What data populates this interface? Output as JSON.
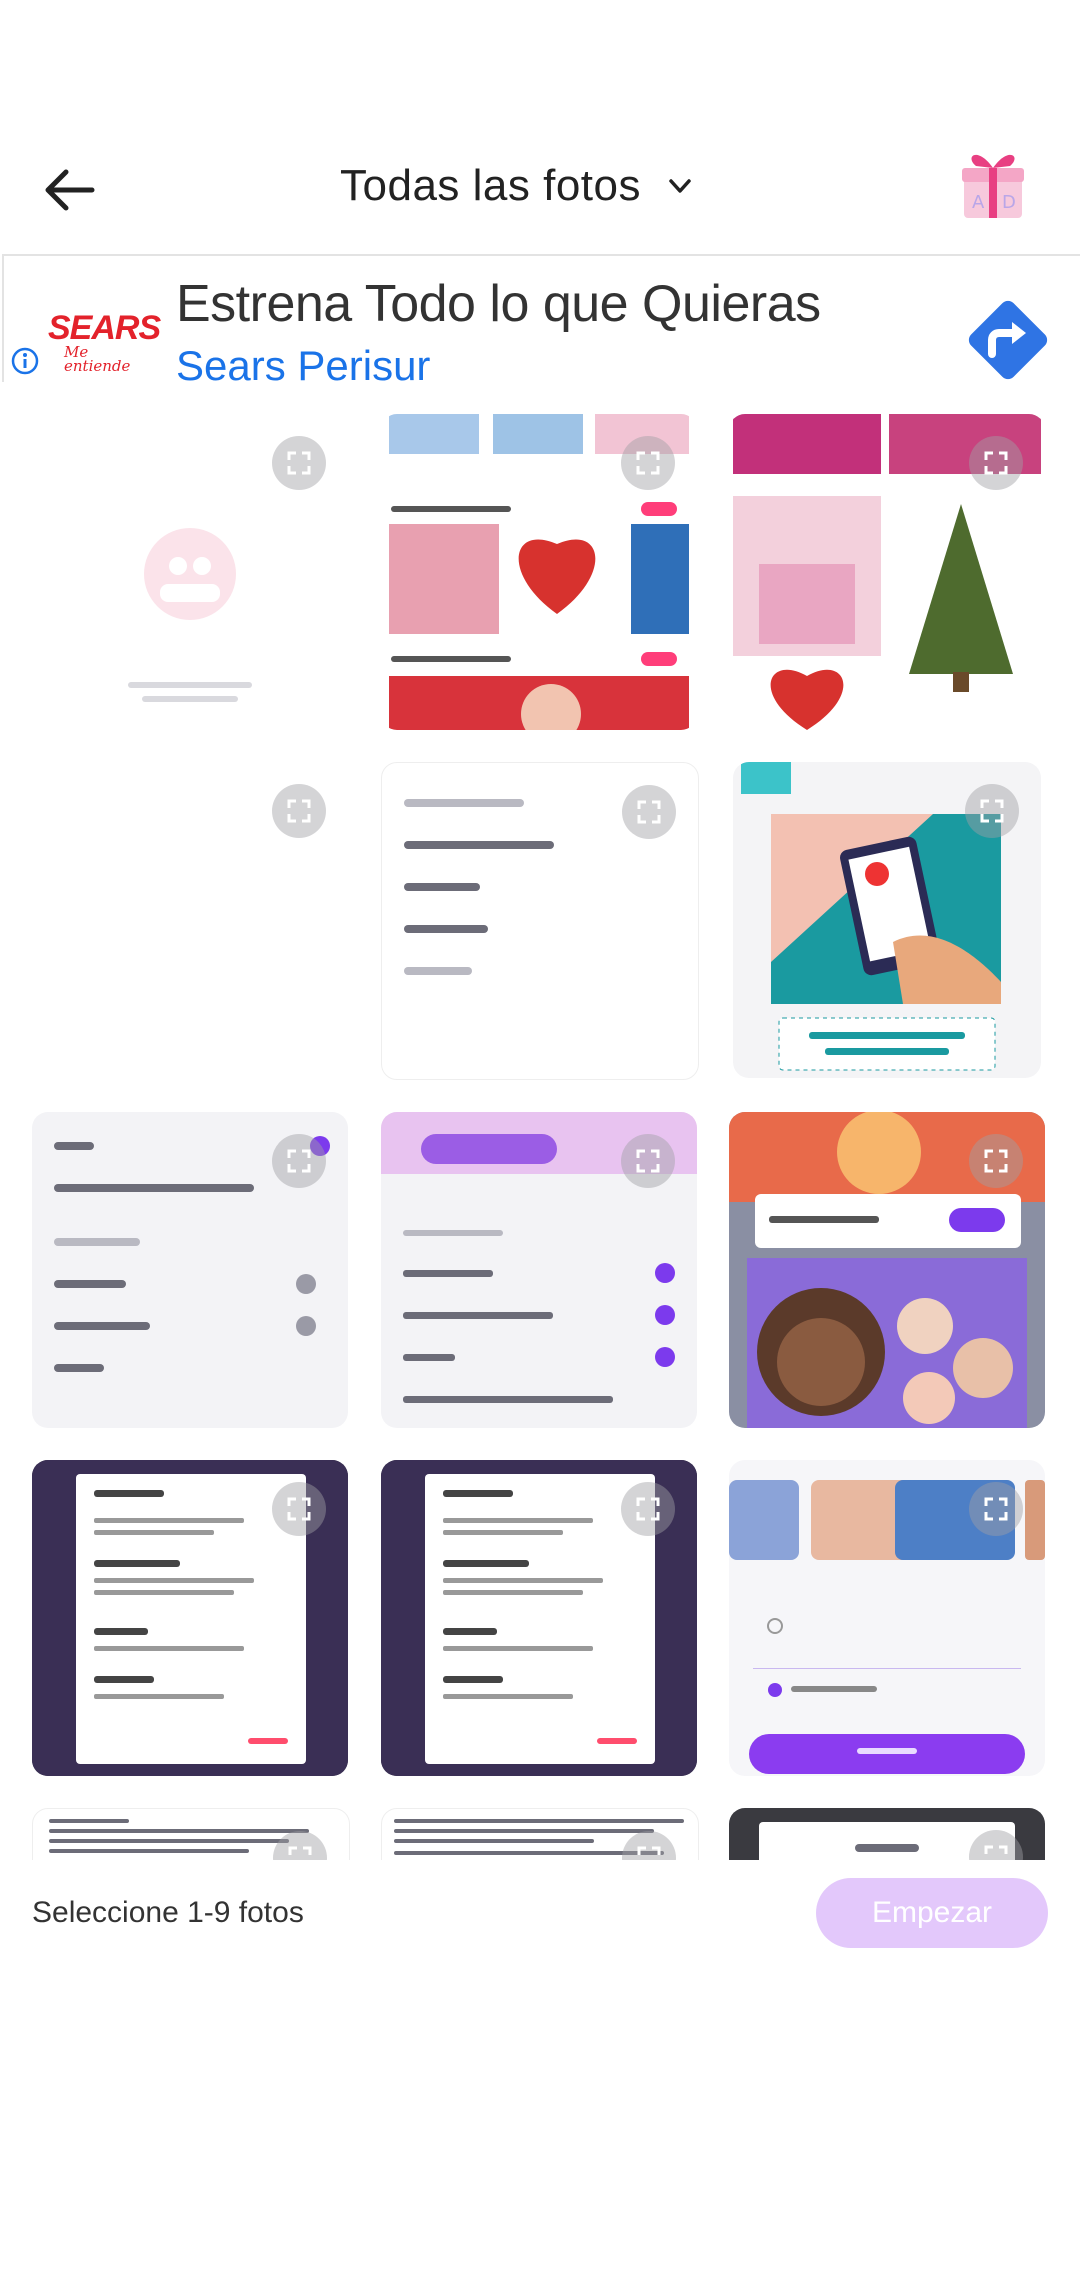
{
  "header": {
    "title": "Todas las fotos",
    "back_icon": "arrow-left-icon",
    "dropdown_icon": "chevron-down-icon",
    "gift_icon": "gift-box-icon"
  },
  "ad": {
    "brand_word": "SEARS",
    "brand_tagline": "Me entiende",
    "headline": "Estrena Todo lo que Quieras",
    "subline": "Sears Perisur",
    "info_icon": "info-icon",
    "cta_icon": "turn-right-arrow-icon",
    "colors": {
      "brand": "#e3222b",
      "link": "#1a73e8"
    }
  },
  "photos": {
    "expand_icon": "expand-icon",
    "count_visible": 15
  },
  "footer": {
    "selection_text": "Seleccione 1-9 fotos",
    "start_label": "Empezar",
    "start_color": "#e3c8fb"
  }
}
